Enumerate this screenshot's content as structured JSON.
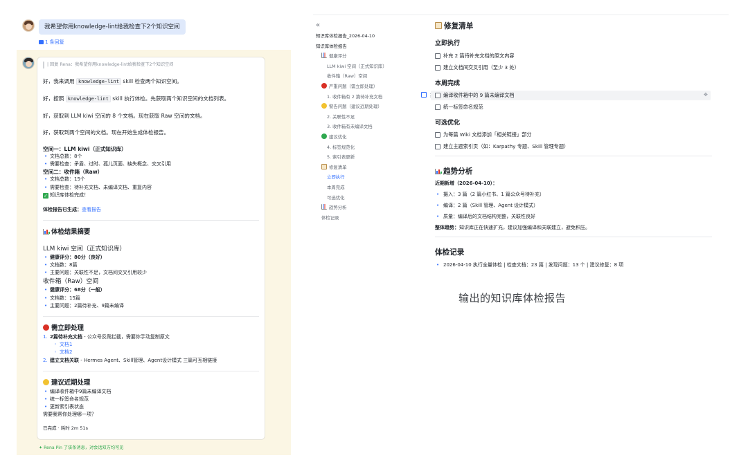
{
  "chat": {
    "user_message": "我希望你用knowledge-lint给我检查下2个知识空间",
    "reply_count": "1 条回复",
    "quote": "| 回复 Rena：我希望你用knowledge-lint给我检查下2个知识空间",
    "msg1_pre": "好，我来调用",
    "msg1_code": "knowledge-lint",
    "msg1_post": "skill 检查两个知识空间。",
    "msg2_pre": "好，按照",
    "msg2_code": "knowledge-lint",
    "msg2_post": "skill 执行体检。先获取两个知识空间的文档列表。",
    "msg3": "好，获取到 LLM kiwi 空间的 8 个文档。现在获取 Raw 空间的文档。",
    "msg4": "好，获取到两个空间的文档。现在开始生成体检报告。",
    "space1_title": "空间一：LLM kiwi（正式知识库）",
    "space1_items": [
      "文档总数：8个",
      "需要检查：矛盾、过时、孤儿页面、缺失概念、交叉引用"
    ],
    "space2_title": "空间二：收件箱（Raw）",
    "space2_items": [
      "文档总数：15个",
      "需要检查：待补充文档、未编译文档、重复内容"
    ],
    "done_line": "知识库体检完成！",
    "report_label": "体检报告已生成：",
    "report_link": "查看报告",
    "summary_title": "体检结果摘要",
    "kiwi_title": "LLM kiwi 空间（正式知识库）",
    "kiwi_score_label": "健康评分：",
    "kiwi_score": "80分（良好）",
    "kiwi_items": [
      "文档数：8篇",
      "主要问题：关联性不足，文档间交叉引用较少"
    ],
    "inbox_title": "收件箱（Raw）空间",
    "inbox_score_label": "健康评分：",
    "inbox_score": "68分（一般）",
    "inbox_items": [
      "文档数：15篇",
      "主要问题：2篇待补充、9篇未编译"
    ],
    "urgent_title": "需立即处理",
    "urgent1_bold": "2篇待补充文档",
    "urgent1_rest": " - 公众号反爬拦截，需要你手动复制原文",
    "urgent1_subs": [
      "文档1",
      "文档2"
    ],
    "urgent2_bold": "建立文档关联",
    "urgent2_rest": " - Hermes Agent、Skill管理、Agent设计模式 三篇可互相链接",
    "recent_title": "建议近期处理",
    "recent_items": [
      "编译收件箱中9篇未编译文档",
      "统一标签命名规范",
      "更新索引表状态"
    ],
    "question": "需要我帮你处理哪一项？",
    "finished": "已完成 · 耗时 2m 51s",
    "pin_note": "Rena Pin 了该条消息，对会话双方均可见"
  },
  "doc": {
    "collapse_icon": "«",
    "toc": [
      {
        "label": "知识库体检报告_2026-04-10",
        "level": 0
      },
      {
        "label": "知识库体检报告",
        "level": 0
      },
      {
        "label": "健康评分",
        "level": 1,
        "icon": "chart"
      },
      {
        "label": "LLM kiwi 空间（正式知识库）",
        "level": 2
      },
      {
        "label": "收件箱（Raw）空间",
        "level": 2
      },
      {
        "label": "严重问题（需立即处理）",
        "level": 1,
        "icon": "red"
      },
      {
        "label": "1. 收件箱有 2 篇待补充文档",
        "level": 2
      },
      {
        "label": "警告问题（建议近期处理）",
        "level": 1,
        "icon": "yellow"
      },
      {
        "label": "2. 关联性不足",
        "level": 2
      },
      {
        "label": "3. 收件箱有未编译文档",
        "level": 2
      },
      {
        "label": "建议优化",
        "level": 1,
        "icon": "green"
      },
      {
        "label": "4. 标签规范化",
        "level": 2
      },
      {
        "label": "5. 索引表更新",
        "level": 2
      },
      {
        "label": "修复清单",
        "level": 1,
        "icon": "doc"
      },
      {
        "label": "立即执行",
        "level": 2,
        "active": true
      },
      {
        "label": "本周完成",
        "level": 2
      },
      {
        "label": "可选优化",
        "level": 2
      },
      {
        "label": "趋势分析",
        "level": 1,
        "icon": "chart"
      },
      {
        "label": "体检记录",
        "level": 1
      }
    ],
    "fix_title": "修复清单",
    "now_title": "立即执行",
    "now_tasks": [
      "补充 2 篇待补充文档的原文内容",
      "建立文档间交叉引用（至少 3 处）"
    ],
    "week_title": "本周完成",
    "week_tasks": [
      "编译收件箱中的 9 篇未编译文档",
      "统一标签命名规范"
    ],
    "optional_title": "可选优化",
    "optional_tasks": [
      "为每篇 Wiki 文档添加「相关链接」部分",
      "建立主题索引页（如：Karpathy 专题、Skill 管理专题）"
    ],
    "trend_title": "趋势分析",
    "trend_sub": "近期新增（2026-04-10）：",
    "trend_items": [
      "摄入：3 篇（2 篇小红书、1 篇公众号待补充）",
      "编译：2 篇（Skill 管理、Agent 设计模式）",
      "质量：编译后的文档结构完整，关联性良好"
    ],
    "overall_label": "整体趋势：",
    "overall_text": "知识库正在快速扩充，建议加强编译和关联建立，避免积压。",
    "record_title": "体检记录",
    "record_item": "2026-04-10 执行全量体检 | 检查文档：23 篇 | 发现问题：13 个 | 建议修复：8 项"
  },
  "caption": "输出的知识库体检报告"
}
